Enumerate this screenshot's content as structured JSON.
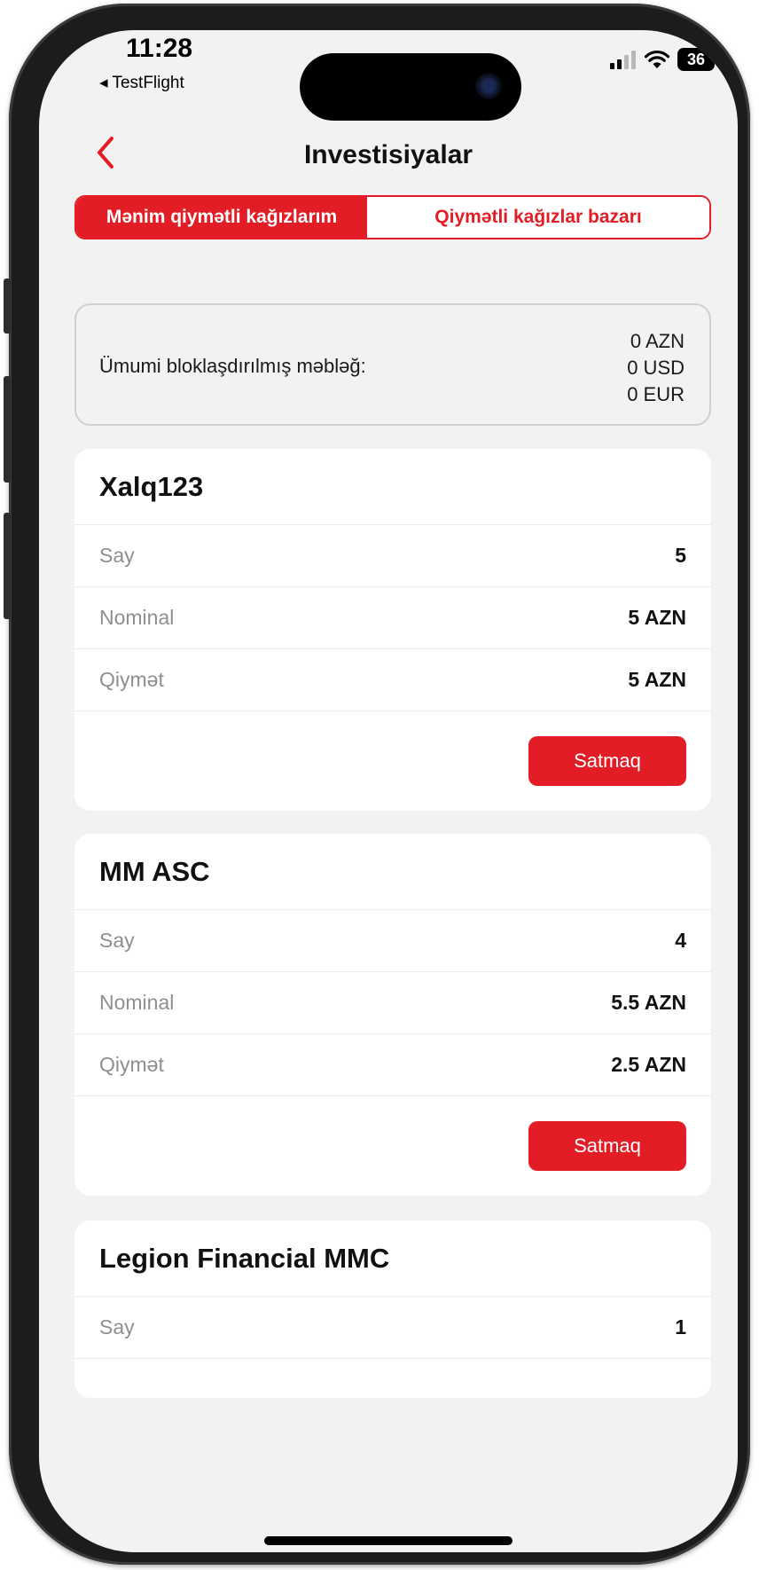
{
  "status_bar": {
    "time": "11:28",
    "back_app": "◂ TestFlight",
    "battery": "36"
  },
  "nav": {
    "title": "Investisiyalar"
  },
  "segments": {
    "active": "Mənim qiymətli kağızlarım",
    "inactive": "Qiymətli kağızlar bazarı"
  },
  "summary": {
    "label": "Ümumi bloklaşdırılmış məbləğ:",
    "azn": "0 AZN",
    "usd": "0 USD",
    "eur": "0 EUR"
  },
  "holdings": [
    {
      "name": "Xalq123",
      "say_label": "Say",
      "say": "5",
      "nominal_label": "Nominal",
      "nominal": "5 AZN",
      "price_label": "Qiymət",
      "price": "5 AZN",
      "sell_label": "Satmaq"
    },
    {
      "name": "MM ASC",
      "say_label": "Say",
      "say": "4",
      "nominal_label": "Nominal",
      "nominal": "5.5 AZN",
      "price_label": "Qiymət",
      "price": "2.5 AZN",
      "sell_label": "Satmaq"
    },
    {
      "name": "Legion Financial MMC",
      "say_label": "Say",
      "say": "1"
    }
  ],
  "colors": {
    "accent": "#e21d25",
    "background": "#f2f2f2",
    "card": "#ffffff",
    "muted_text": "#8e8e93"
  }
}
